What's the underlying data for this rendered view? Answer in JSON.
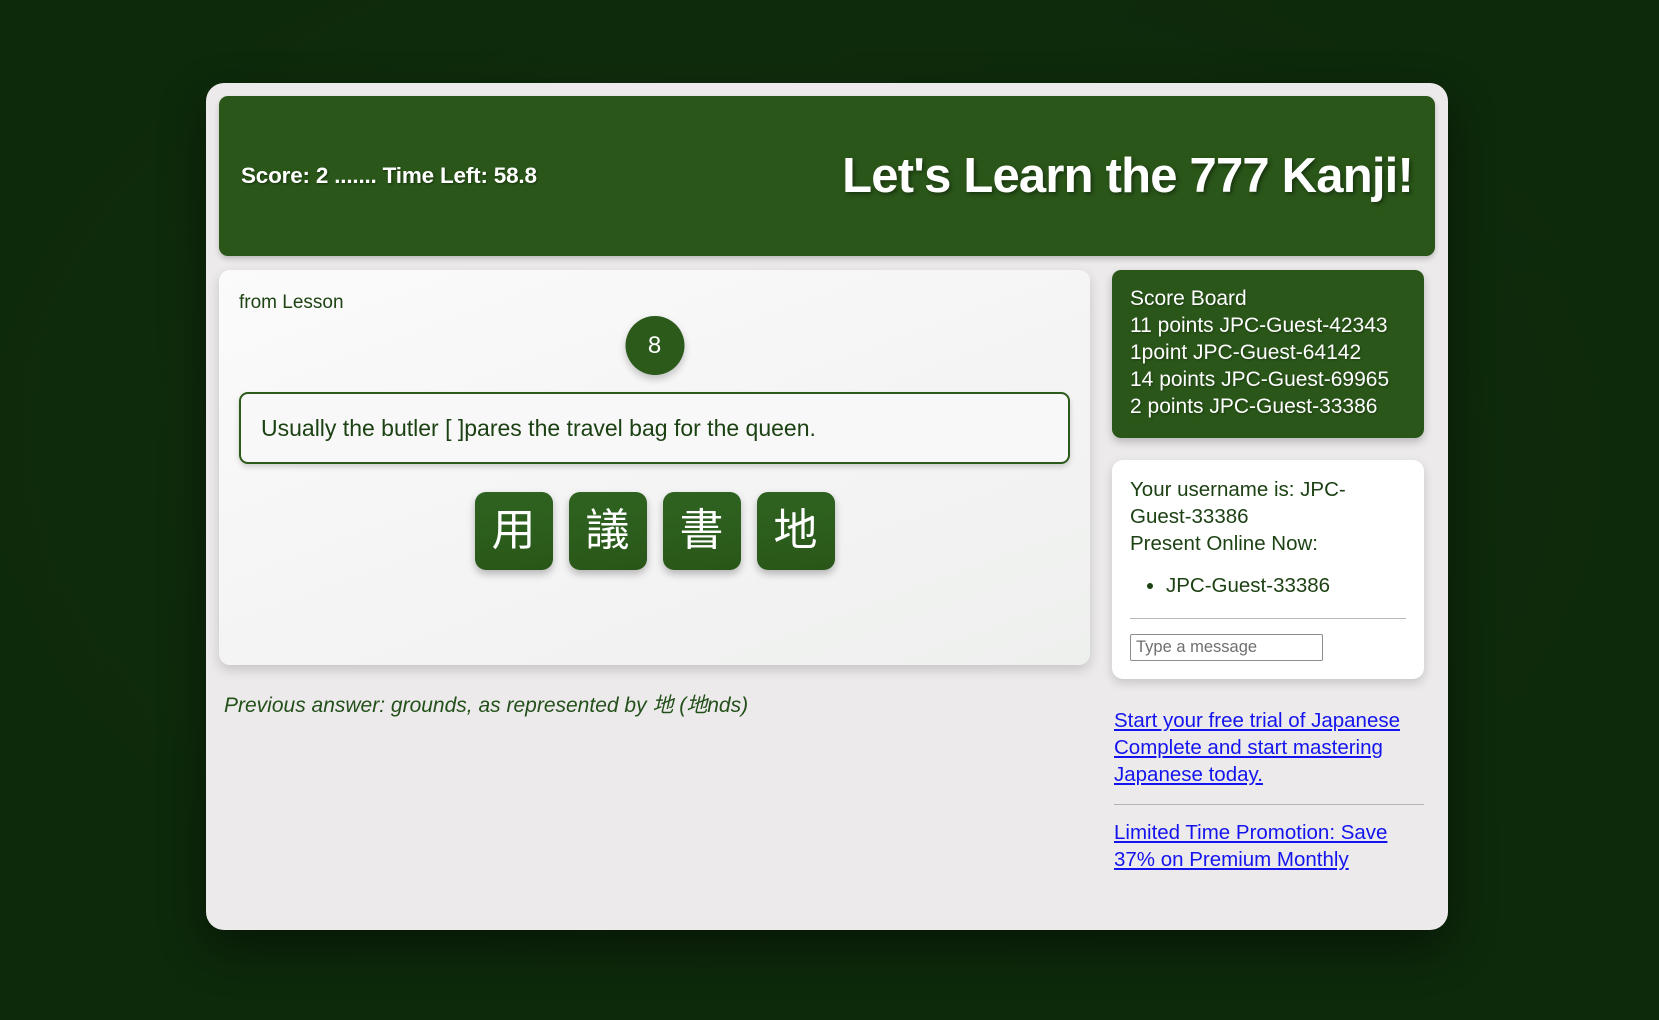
{
  "header": {
    "score_line": "Score: 2 ....... Time Left: 58.8",
    "title": "Let's Learn the 777 Kanji!",
    "bg_color": "#2a5719"
  },
  "question": {
    "from_lesson_label": "from Lesson",
    "lesson_number": "8",
    "sentence": "Usually the butler [ ]pares the travel bag for the queen.",
    "choices": [
      "用",
      "議",
      "書",
      "地"
    ]
  },
  "previous_answer": "Previous answer: grounds, as represented by 地 (地nds)",
  "scoreboard": {
    "title": "Score Board",
    "entries": [
      "11 points JPC-Guest-42343",
      "1point JPC-Guest-64142",
      "14 points JPC-Guest-69965",
      "2 points JPC-Guest-33386"
    ]
  },
  "user_panel": {
    "username_line": "Your username is: JPC-Guest-33386",
    "present_label": "Present Online Now:",
    "online_users": [
      "JPC-Guest-33386"
    ],
    "message_placeholder": "Type a message"
  },
  "promos": [
    "Start your free trial of Japanese Complete and start mastering Japanese today.",
    "Limited Time Promotion: Save 37% on Premium Monthly"
  ],
  "colors": {
    "page_background": "#12300f",
    "accent_green": "#2a5719",
    "link_blue": "#1414ee"
  }
}
